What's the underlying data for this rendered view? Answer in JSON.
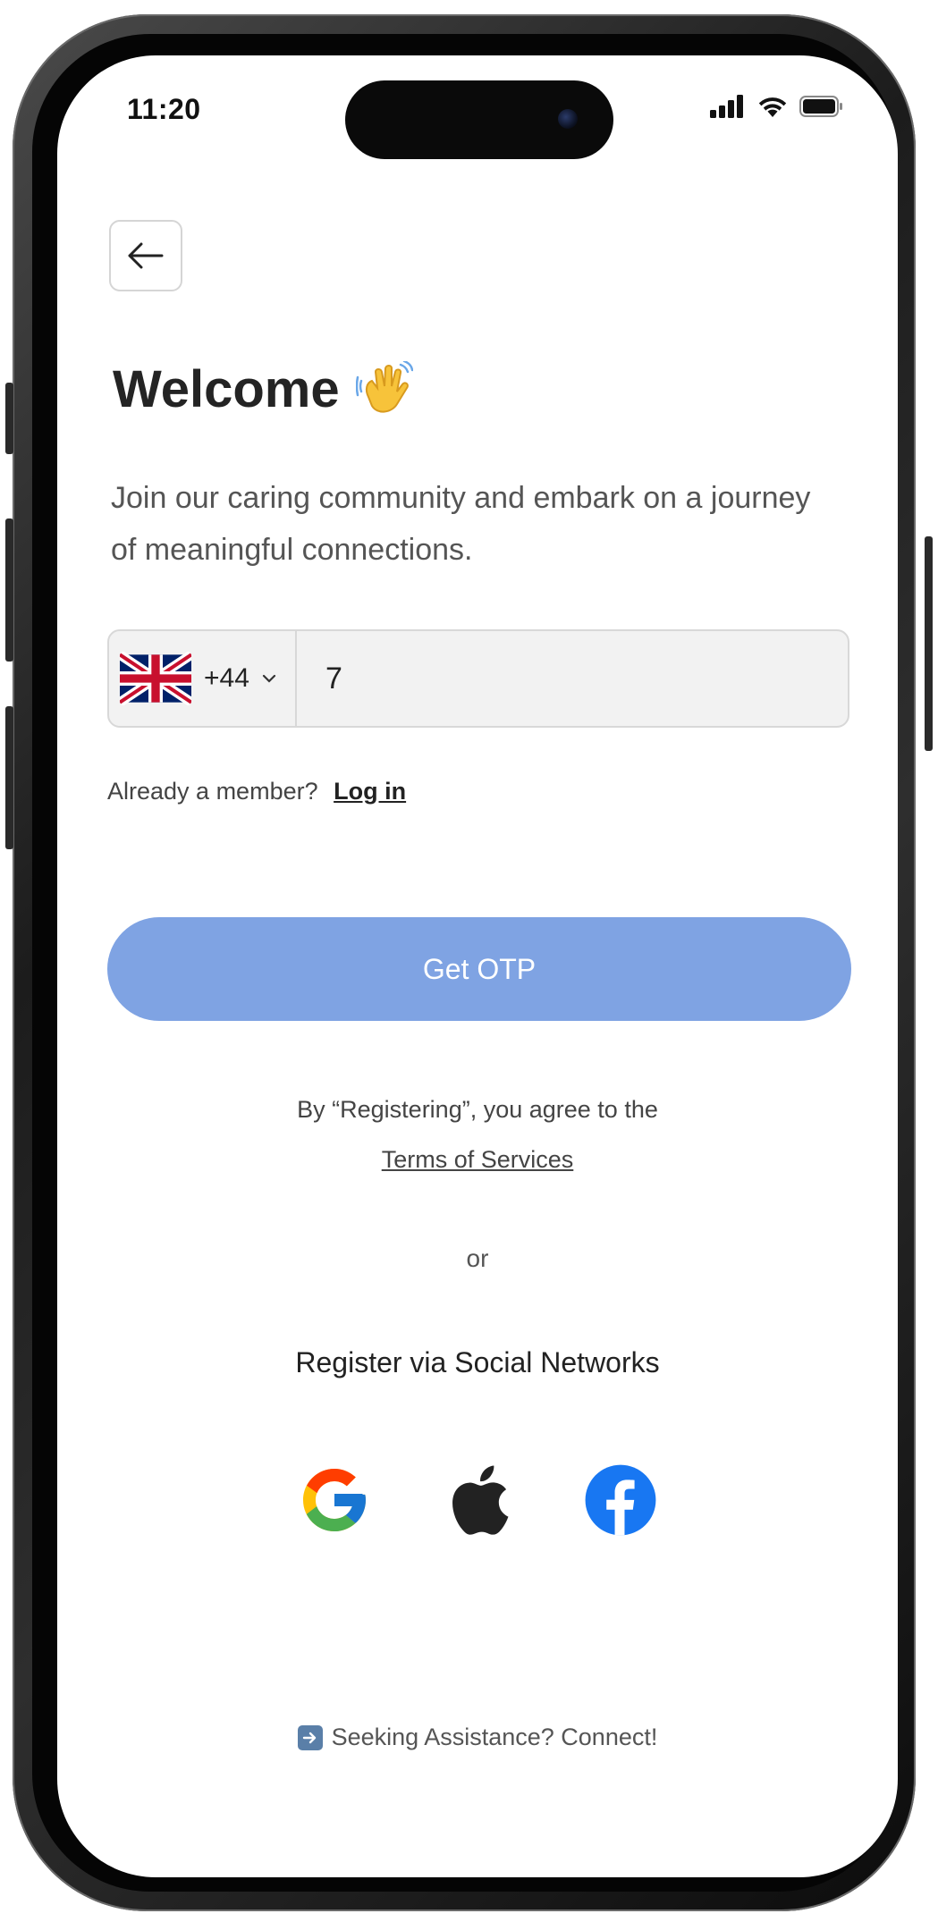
{
  "status_bar": {
    "time": "11:20"
  },
  "header": {
    "title": "Welcome",
    "title_emoji": "waving-hand-icon"
  },
  "intro": {
    "text": "Join our caring community and embark on a journey of meaningful connections."
  },
  "phone_input": {
    "country_flag": "uk-flag-icon",
    "country_code": "+44",
    "value": "7"
  },
  "login_prompt": {
    "text": "Already a member?",
    "link": "Log in"
  },
  "otp_button": {
    "label": "Get OTP",
    "color": "#7fa3e3"
  },
  "legal": {
    "agree_text": "By “Registering”, you agree to the",
    "terms_link": "Terms of Services"
  },
  "divider": {
    "text": "or"
  },
  "social": {
    "title": "Register via Social Networks",
    "providers": [
      "google-icon",
      "apple-icon",
      "facebook-icon"
    ]
  },
  "help": {
    "text": "Seeking Assistance? Connect!"
  }
}
